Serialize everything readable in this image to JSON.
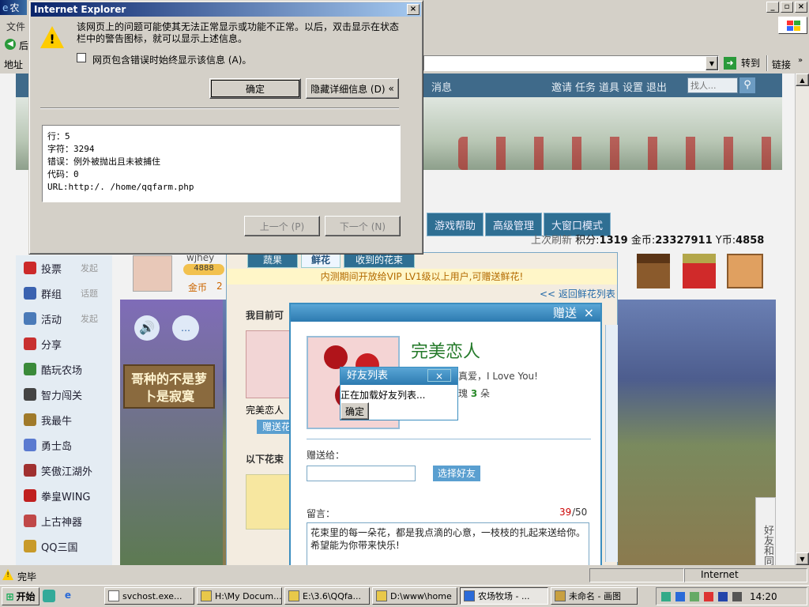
{
  "browser": {
    "title": "农",
    "menu_file": "文件",
    "toolbar_back": "后",
    "address_label": "地址",
    "go_label": "转到",
    "links_label": "链接",
    "status_text": "完毕",
    "zone": "Internet"
  },
  "page": {
    "nav": {
      "messages": "消息",
      "invite": "邀请",
      "tasks": "任务",
      "props": "道具",
      "settings": "设置",
      "logout": "退出",
      "search_placeholder": "找人..."
    },
    "tabs": [
      "游戏帮助",
      "高级管理",
      "大窗口模式"
    ],
    "stats": {
      "last_refresh": "上次刷新",
      "points_label": "积分:",
      "points": "1319",
      "gold_label": "金币:",
      "gold": "23327911",
      "ybi_label": "Y币:",
      "ybi": "4858"
    },
    "user": {
      "name": "wjhey",
      "level": "4888",
      "gold_label": "金币",
      "gold_value": "2"
    },
    "sidebar": [
      {
        "label": "投票",
        "sub": "发起"
      },
      {
        "label": "群组",
        "sub": "话题"
      },
      {
        "label": "活动",
        "sub": "发起"
      },
      {
        "label": "分享",
        "sub": ""
      },
      {
        "label": "酷玩农场",
        "sub": ""
      },
      {
        "label": "智力闯关",
        "sub": ""
      },
      {
        "label": "我最牛",
        "sub": ""
      },
      {
        "label": "勇士岛",
        "sub": ""
      },
      {
        "label": "笑傲江湖外",
        "sub": ""
      },
      {
        "label": "拳皇WING",
        "sub": ""
      },
      {
        "label": "上古神器",
        "sub": ""
      },
      {
        "label": "QQ三国",
        "sub": ""
      }
    ],
    "sign_text": "哥种的不是萝卜是寂寞",
    "side_tab": "好友和同学"
  },
  "flower_panel": {
    "tabs": [
      "蔬果",
      "鲜花",
      "收到的花束"
    ],
    "notice": "内测期间开放给VIP LV1级以上用户,可赠送鲜花!",
    "back_link": "<< 返回鲜花列表",
    "my_flowers": "我目前可",
    "flower_name_small": "完美恋人",
    "gift_btn_small": "赠送花",
    "below_label": "以下花束"
  },
  "gift_dialog": {
    "title": "赠送",
    "flower_name": "完美恋人",
    "language_line": "花语：热情真爱，I Love You!",
    "need_label": "需要：红玫瑰",
    "need_count": "3",
    "need_unit": "朵",
    "give_to_label": "赠送给：",
    "choose_friend": "选择好友",
    "message_label": "留言：",
    "count_current": "39",
    "count_max": "/50",
    "message_text": "花束里的每一朵花，都是我点滴的心意，一枝枝的扎起来送给你。希望能为你带来快乐!"
  },
  "friend_popup": {
    "title": "好友列表",
    "loading": "正在加载好友列表...",
    "ok": "确定"
  },
  "ie_dialog": {
    "title": "Internet Explorer",
    "message": "该网页上的问题可能使其无法正常显示或功能不正常。以后，双击显示在状态栏中的警告图标，就可以显示上述信息。",
    "checkbox_label": "网页包含错误时始终显示该信息 (A)。",
    "ok": "确定",
    "hide_details": "隐藏详细信息 (D)",
    "details": [
      {
        "label": "行：",
        "value": "5"
      },
      {
        "label": "字符：",
        "value": "3294"
      },
      {
        "label": "错误：",
        "value": "例外被抛出且未被捕住"
      },
      {
        "label": "代码：",
        "value": "0"
      },
      {
        "label": "URL:",
        "value": "http:/.            /home/qqfarm.php"
      }
    ],
    "prev": "上一个 (P)",
    "next": "下一个 (N)"
  },
  "taskbar": {
    "start": "开始",
    "tasks": [
      "svchost.exe...",
      "H:\\My Docum...",
      "E:\\3.6\\QQfa...",
      "D:\\www\\home",
      "农场牧场 - ...",
      "未命名 - 画图"
    ],
    "active_index": 4,
    "clock": "14:20"
  }
}
